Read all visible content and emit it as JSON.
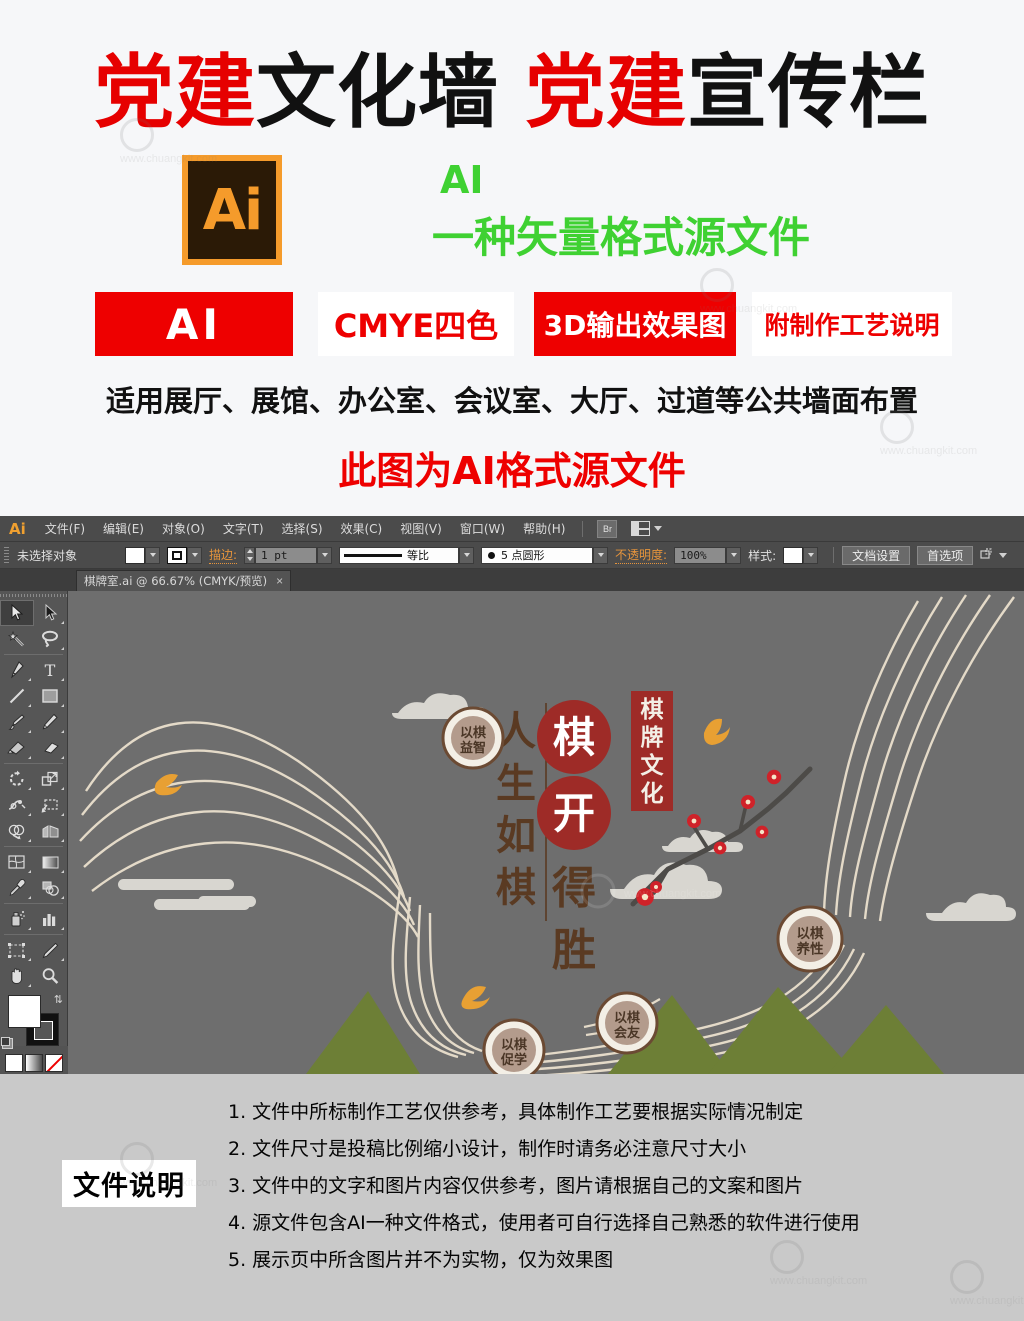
{
  "promo": {
    "title_parts": [
      {
        "text": "党建",
        "color": "red"
      },
      {
        "text": "文化墙",
        "color": "black"
      },
      {
        "text": "党建",
        "color": "red"
      },
      {
        "text": "宣传栏",
        "color": "black"
      }
    ],
    "ai_icon_label": "Ai",
    "ai_green_title": "AI",
    "ai_green_sub": "一种矢量格式源文件",
    "badges": [
      {
        "label": "AI",
        "style": "solid"
      },
      {
        "label": "CMYE四色",
        "style": "ghost"
      },
      {
        "label": "3D输出效果图",
        "style": "solid"
      },
      {
        "label": "附制作工艺说明",
        "style": "ghost"
      }
    ],
    "subtitle": "适用展厅、展馆、办公室、会议室、大厅、过道等公共墙面布置",
    "red_note": "此图为AI格式源文件",
    "watermark_text": "www.chuangkit.com",
    "colors": {
      "red": "#ee0000",
      "green": "#3fd132",
      "orange": "#f59b2b",
      "dark": "#2b1a06"
    }
  },
  "app": {
    "logo": "Ai",
    "menu": [
      "文件(F)",
      "编辑(E)",
      "对象(O)",
      "文字(T)",
      "选择(S)",
      "效果(C)",
      "视图(V)",
      "窗口(W)",
      "帮助(H)"
    ],
    "bridge_button": "Br",
    "control": {
      "selection_status": "未选择对象",
      "stroke_label": "描边:",
      "stroke_weight": "1 pt",
      "profile_label": "等比",
      "brush_label": "5 点圆形",
      "opacity_label": "不透明度:",
      "opacity_value": "100%",
      "style_label": "样式:",
      "doc_setup_button": "文档设置",
      "preferences_button": "首选项"
    },
    "document_tab": {
      "title": "棋牌室.ai @ 66.67% (CMYK/预览)",
      "close": "×"
    },
    "tools": [
      "selection-tool",
      "direct-selection-tool",
      "magic-wand-tool",
      "lasso-tool",
      "pen-tool",
      "type-tool",
      "line-segment-tool",
      "rectangle-tool",
      "paintbrush-tool",
      "pencil-tool",
      "shaper-tool",
      "eraser-tool",
      "rotate-tool",
      "scale-tool",
      "width-tool",
      "free-transform-tool",
      "shape-builder-tool",
      "perspective-grid-tool",
      "mesh-tool",
      "gradient-tool",
      "eyedropper-tool",
      "blend-tool",
      "symbol-sprayer-tool",
      "column-graph-tool",
      "artboard-tool",
      "slice-tool",
      "hand-tool",
      "zoom-tool"
    ],
    "artwork": {
      "headline_vertical": "人生如棋",
      "circle_chars": [
        "棋",
        "开"
      ],
      "brown_chars": [
        "得",
        "胜"
      ],
      "banner_vertical": "棋牌文化",
      "medallions": [
        "以棋益智",
        "以棋促学",
        "以棋会友",
        "以棋养性"
      ],
      "colors": {
        "background": "#6e6e6e",
        "red": "#9e2b27",
        "brown": "#5a3a22",
        "rope": "#e4dac8",
        "cloud": "#d8d6d0",
        "mountain": "#6d7f36",
        "bird": "#e8a033",
        "medallion_face": "#b39b8c",
        "medallion_ring": "#f3efe6"
      }
    }
  },
  "notes": {
    "label": "文件说明",
    "items": [
      "1. 文件中所标制作工艺仅供参考，具体制作工艺要根据实际情况制定",
      "2. 文件尺寸是投稿比例缩小设计，制作时请务必注意尺寸大小",
      "3. 文件中的文字和图片内容仅供参考，图片请根据自己的文案和图片",
      "4. 源文件包含AI一种文件格式，使用者可自行选择自己熟悉的软件进行使用",
      "5. 展示页中所含图片并不为实物，仅为效果图"
    ]
  }
}
